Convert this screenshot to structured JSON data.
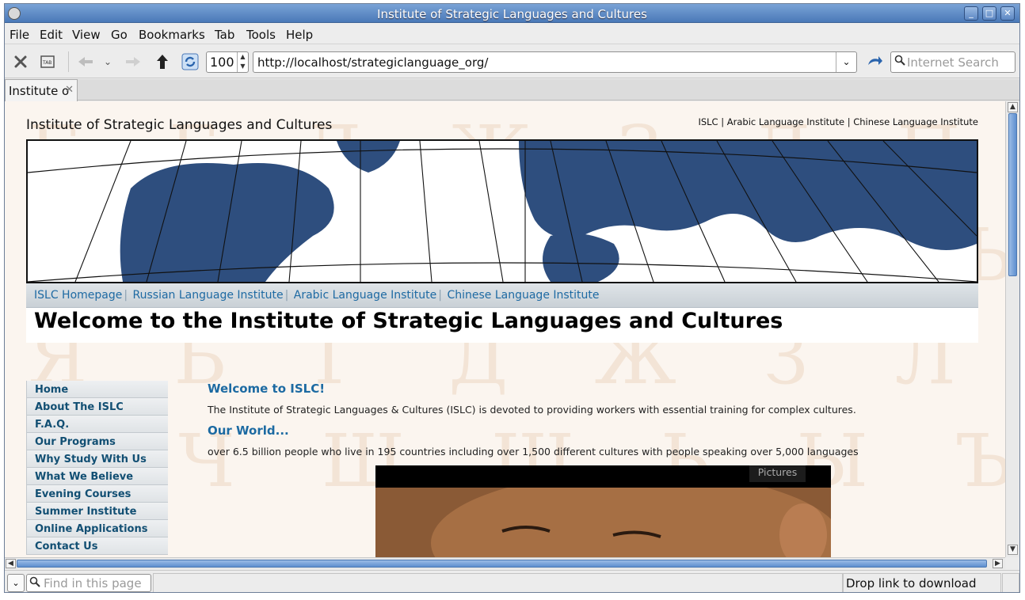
{
  "window": {
    "title": "Institute of Strategic Languages and Cultures",
    "minimize": "_",
    "maximize": "□",
    "close": "✕"
  },
  "menubar": {
    "items": [
      "File",
      "Edit",
      "View",
      "Go",
      "Bookmarks",
      "Tab",
      "Tools",
      "Help"
    ]
  },
  "toolbar": {
    "zoom_value": "100",
    "url": "http://localhost/strategiclanguage_org/",
    "search_placeholder": "Internet Search"
  },
  "tabs": [
    {
      "label": "Institute o"
    }
  ],
  "page": {
    "site_title": "Institute of Strategic Languages and Cultures",
    "top_links": "ISLC | Arabic Language Institute | Chinese Language Institute",
    "nav": [
      "ISLC Homepage",
      "Russian Language Institute",
      "Arabic Language Institute",
      "Chinese Language Institute"
    ],
    "heading": "Welcome to the Institute of Strategic Languages and Cultures",
    "side_nav": [
      "Home",
      "About The ISLC",
      "F.A.Q.",
      "Our Programs",
      "Why Study With Us",
      "What We Believe",
      "Evening Courses",
      "Summer Institute",
      "Online Applications",
      "Contact Us"
    ],
    "welcome_heading": "Welcome to ISLC!",
    "welcome_text": "The Institute of Strategic Languages & Cultures (ISLC) is devoted to providing workers with essential training for complex cultures.",
    "world_heading": "Our World...",
    "world_text": "over 6.5 billion people who live in 195 countries including over 1,500 different cultures with people speaking over 5,000 languages",
    "pictures_label": "Pictures"
  },
  "statusbar": {
    "find_placeholder": "Find in this page",
    "drop_text": "Drop link to download"
  },
  "colors": {
    "link": "#1e6aa3",
    "titlebar": "#5b86c2",
    "map_ocean": "#2e4e7e"
  }
}
